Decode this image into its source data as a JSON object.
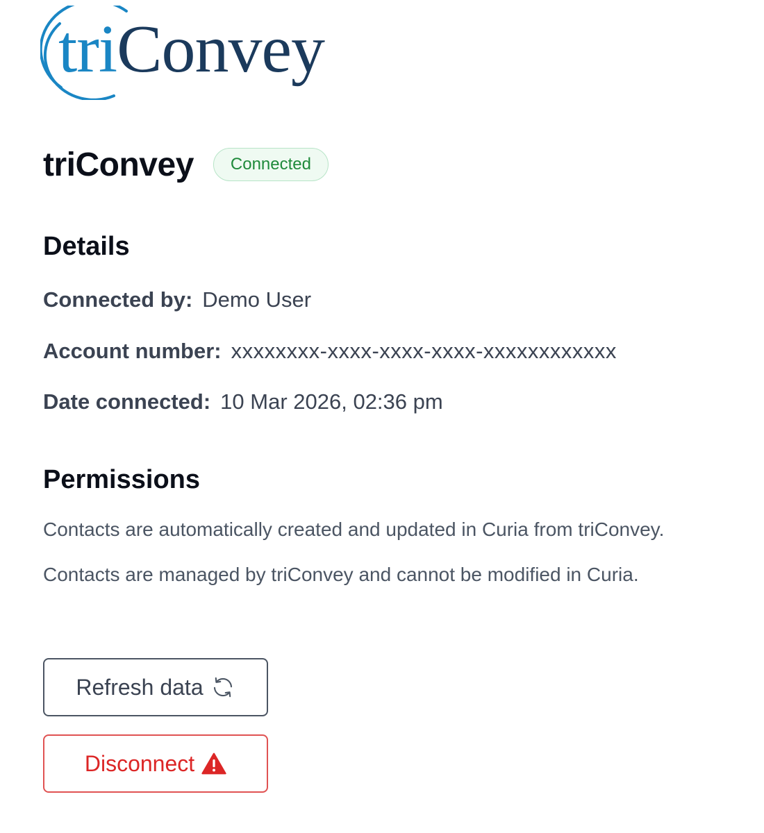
{
  "logo": {
    "tri": "tri",
    "convey": "Convey",
    "colors": {
      "tri": "#1a86c4",
      "convey": "#1b3a5c"
    }
  },
  "header": {
    "title": "triConvey",
    "status": "Connected",
    "status_color": "#1f8a3b"
  },
  "details": {
    "heading": "Details",
    "connected_by": {
      "label": "Connected by:",
      "value": "Demo User"
    },
    "account_number": {
      "label": "Account number:",
      "value": "xxxxxxxx-xxxx-xxxx-xxxx-xxxxxxxxxxxx"
    },
    "date_connected": {
      "label": "Date connected:",
      "value": "10 Mar 2026, 02:36 pm"
    }
  },
  "permissions": {
    "heading": "Permissions",
    "lines": [
      "Contacts are automatically created and updated in Curia from triConvey.",
      "Contacts are managed by triConvey and cannot be modified in Curia."
    ]
  },
  "actions": {
    "refresh_label": "Refresh data",
    "refresh_icon": "refresh-icon",
    "disconnect_label": "Disconnect",
    "disconnect_icon": "warning-icon",
    "disconnect_color": "#dc2626"
  }
}
